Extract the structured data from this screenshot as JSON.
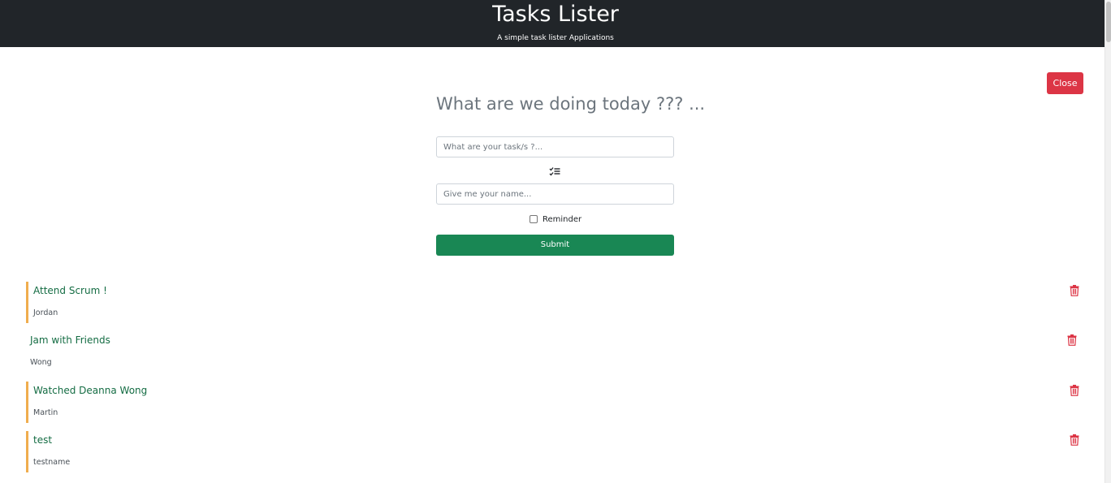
{
  "header": {
    "title": "Tasks Lister",
    "subtitle": "A simple task lister Applications"
  },
  "close_button": {
    "label": "Close",
    "color": "#dc3545"
  },
  "form": {
    "heading": "What are we doing today ??? ...",
    "task_input": {
      "placeholder": "What are your task/s ?...",
      "value": ""
    },
    "name_input": {
      "placeholder": "Give me your name...",
      "value": ""
    },
    "list_icon": "list-check-icon",
    "reminder_label": "Reminder",
    "reminder_checked": false,
    "submit_label": "Submit",
    "submit_color": "#198754"
  },
  "tasks": [
    {
      "text": "Attend Scrum !",
      "name": "Jordan",
      "reminder": true
    },
    {
      "text": "Jam with Friends",
      "name": "Wong",
      "reminder": false
    },
    {
      "text": "Watched Deanna Wong",
      "name": "Martin",
      "reminder": true
    },
    {
      "text": "test",
      "name": "testname",
      "reminder": true
    }
  ],
  "colors": {
    "header_bg": "#212529",
    "reminder_border": "#f0ad4e",
    "task_text": "#146c43",
    "delete_icon": "#dc3545"
  },
  "icons": {
    "delete": "trash-icon"
  }
}
